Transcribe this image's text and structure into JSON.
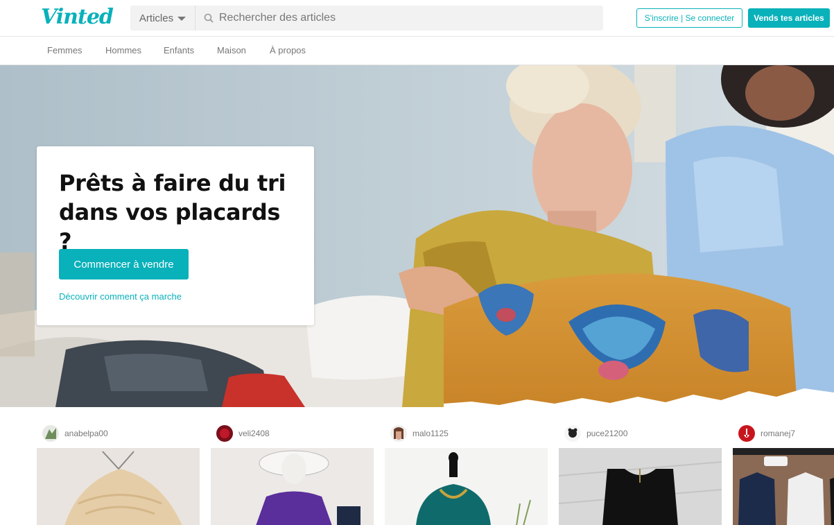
{
  "brand": {
    "logo_text": "Vinted",
    "accent": "#09b1ba"
  },
  "header": {
    "search_category": "Articles",
    "search_placeholder": "Rechercher des articles",
    "login_label": "S'inscrire | Se connecter",
    "sell_label": "Vends tes articles"
  },
  "nav": [
    "Femmes",
    "Hommes",
    "Enfants",
    "Maison",
    "À propos"
  ],
  "hero": {
    "title": "Prêts à faire du tri dans vos placards ?",
    "cta_label": "Commencer à vendre",
    "link_label": "Découvrir comment ça marche"
  },
  "items": [
    {
      "owner": "anabelpa00"
    },
    {
      "owner": "veli2408"
    },
    {
      "owner": "malo1125"
    },
    {
      "owner": "puce21200"
    },
    {
      "owner": "romanej7"
    }
  ],
  "icons": {
    "search": "search-icon",
    "dropdown": "chevron-down-icon"
  }
}
